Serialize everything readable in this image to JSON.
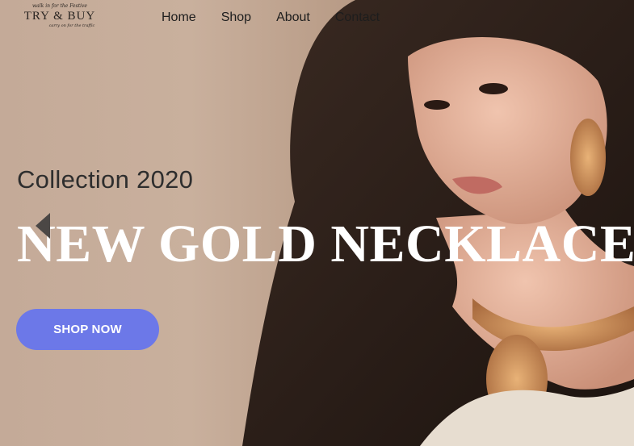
{
  "logo": {
    "tag_top": "walk in for the Festive",
    "brand": "TRY & BUY",
    "tag_bottom": "carry on for the traffic"
  },
  "nav": {
    "items": [
      "Home",
      "Shop",
      "About",
      "Contact"
    ]
  },
  "hero": {
    "subtitle": "Collection 2020",
    "headline": "NEW GOLD NECKLACES",
    "cta_label": "SHOP NOW"
  },
  "colors": {
    "cta": "#6c78e8",
    "headline": "#ffffff",
    "nav_text": "#1d1d1d"
  }
}
